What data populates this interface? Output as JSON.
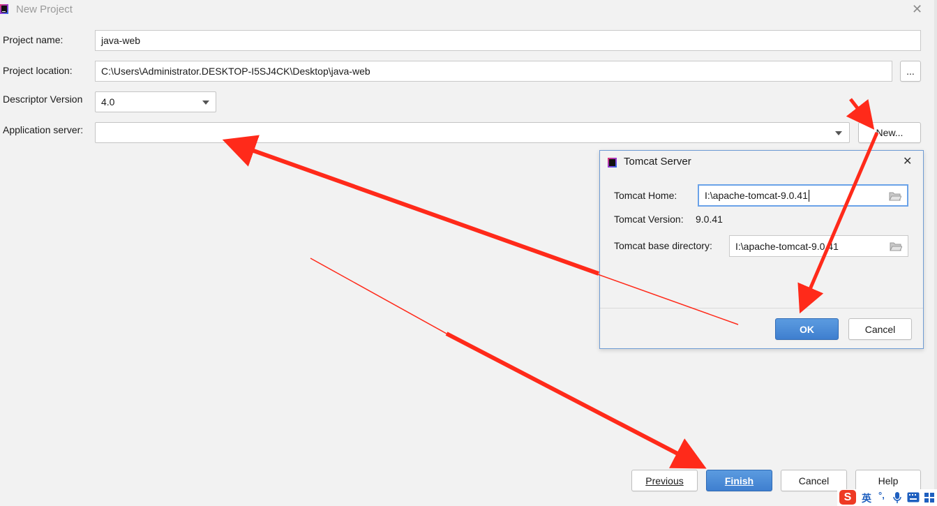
{
  "window": {
    "title": "New Project",
    "close_glyph": "✕"
  },
  "form": {
    "project_name_label": "Project name:",
    "project_name_value": "java-web",
    "project_location_label": "Project location:",
    "project_location_value": "C:\\Users\\Administrator.DESKTOP-I5SJ4CK\\Desktop\\java-web",
    "browse_label": "...",
    "descriptor_version_label": "Descriptor Version",
    "descriptor_version_value": "4.0",
    "application_server_label": "Application server:",
    "application_server_value": "",
    "new_button_label": "New..."
  },
  "footer": {
    "previous_label": "Previous",
    "finish_label": "Finish",
    "cancel_label": "Cancel",
    "help_label": "Help"
  },
  "tomcat_dialog": {
    "title": "Tomcat Server",
    "close_glyph": "✕",
    "home_label": "Tomcat Home:",
    "home_value": "I:\\apache-tomcat-9.0.41",
    "version_label": "Tomcat Version:",
    "version_value": "9.0.41",
    "base_dir_label": "Tomcat base directory:",
    "base_dir_value": "I:\\apache-tomcat-9.0.41",
    "ok_label": "OK",
    "cancel_label": "Cancel"
  },
  "tray": {
    "ime_logo": "S",
    "ime_lang": "英",
    "punct": "°,"
  },
  "annotations": {
    "arrow_color": "#ff2a1a",
    "icons": [
      "app-icon",
      "close-icon",
      "dropdown-caret-icon",
      "folder-icon",
      "tomcat-icon",
      "microphone-icon",
      "keyboard-icon",
      "grid-icon"
    ]
  },
  "colors": {
    "primary_button": "#4a8ad8",
    "dialog_border": "#6e9bd4",
    "focus_ring": "#6aa2e8"
  }
}
